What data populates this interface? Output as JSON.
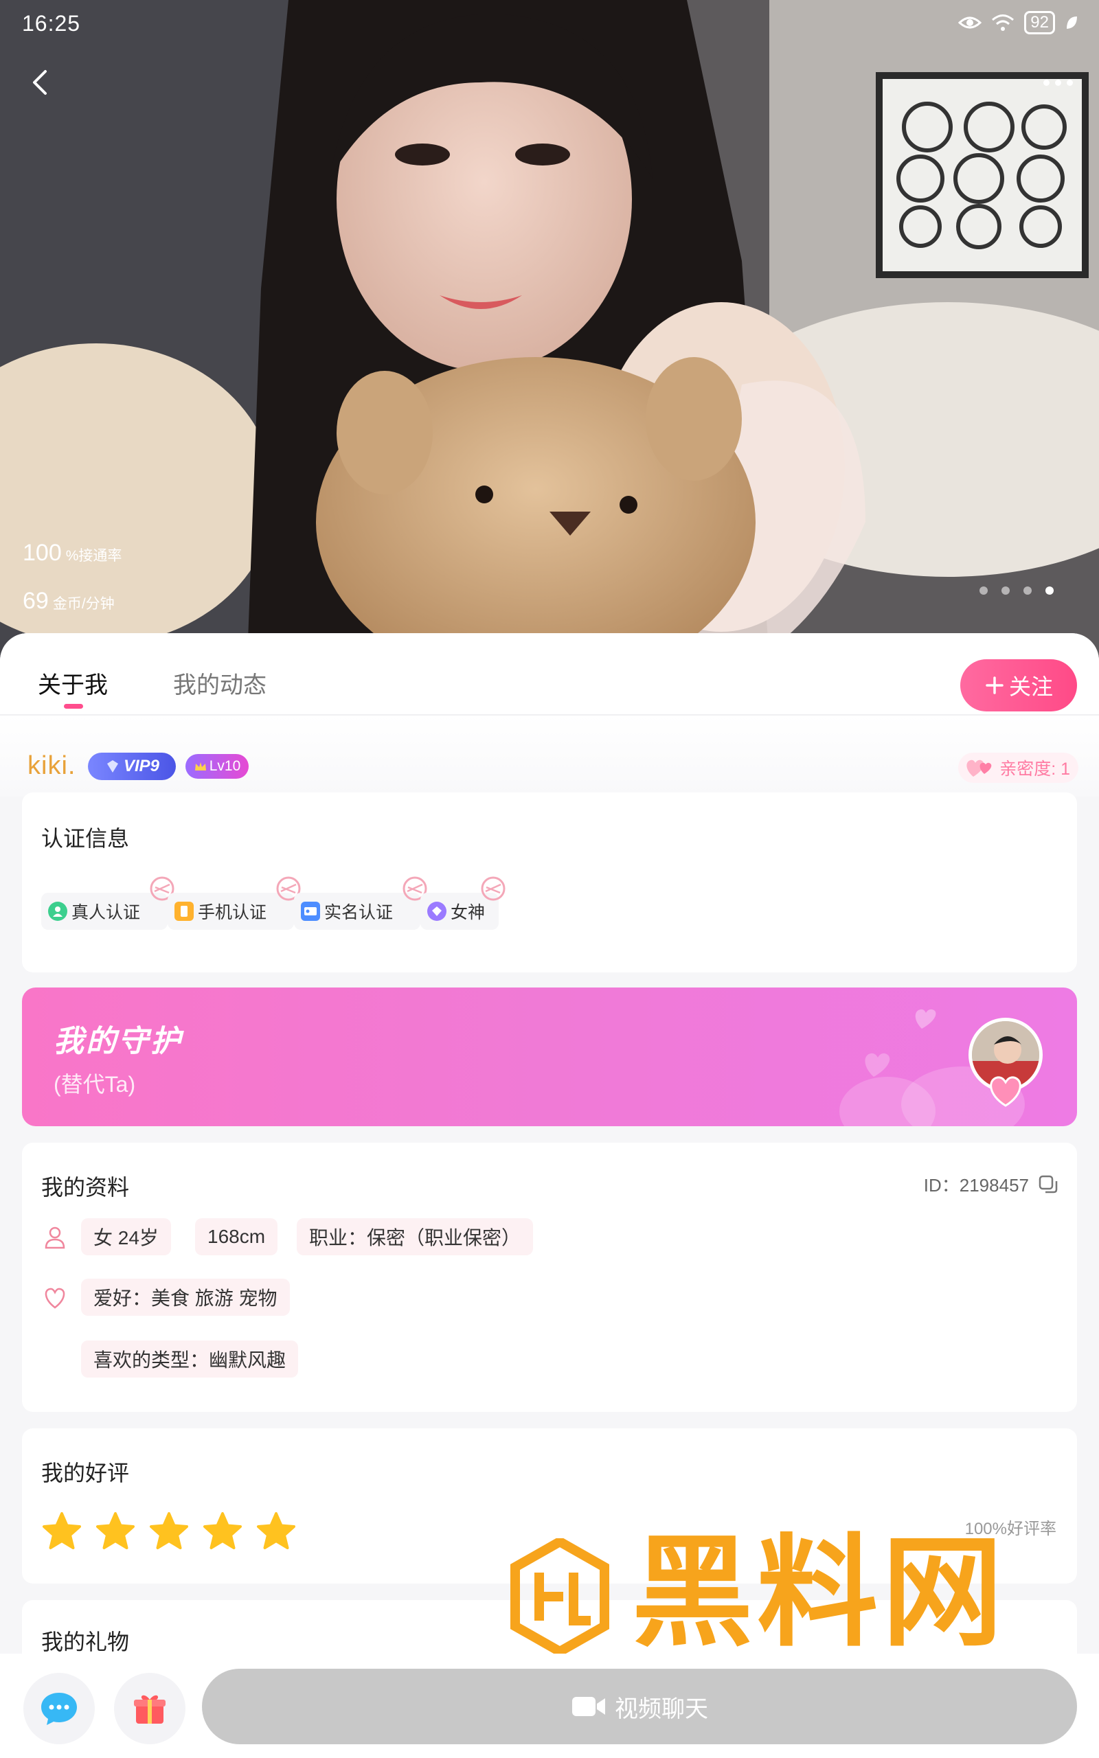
{
  "status_bar": {
    "time": "16:25",
    "battery": "92"
  },
  "hero": {
    "connect_rate_value": "100",
    "connect_rate_label": "%接通率",
    "price_value": "69",
    "price_label": "金币/分钟",
    "photo_count": 4,
    "active_photo_index": 4
  },
  "tabs": {
    "about": "关于我",
    "moments": "我的动态"
  },
  "follow_button": "关注",
  "user": {
    "nickname": "kiki.",
    "vip_label": "VIP9",
    "level_label": "Lv10",
    "intimacy": "亲密度: 1"
  },
  "auth": {
    "title": "认证信息",
    "items": [
      "真人认证",
      "手机认证",
      "实名认证",
      "女神"
    ]
  },
  "guard": {
    "title": "我的守护",
    "subtitle": "(替代Ta)"
  },
  "profile": {
    "title": "我的资料",
    "id_label": "ID：2198457",
    "gender_age": "女  24岁",
    "height": "168cm",
    "job": "职业：保密（职业保密）",
    "hobby": "爱好：美食 旅游 宠物",
    "type": "喜欢的类型：幽默风趣"
  },
  "review": {
    "title": "我的好评",
    "stars": 5,
    "rate": "100%好评率"
  },
  "gifts": {
    "title": "我的礼物"
  },
  "bottom": {
    "video_chat": "视频聊天"
  },
  "watermark": {
    "text": "黑料网",
    "url": "https://hlwe1.com"
  },
  "colors": {
    "accent": "#ff4d8d",
    "guard": "#f07ad6",
    "star": "#ffc21f",
    "watermark": "#f7a41c"
  }
}
